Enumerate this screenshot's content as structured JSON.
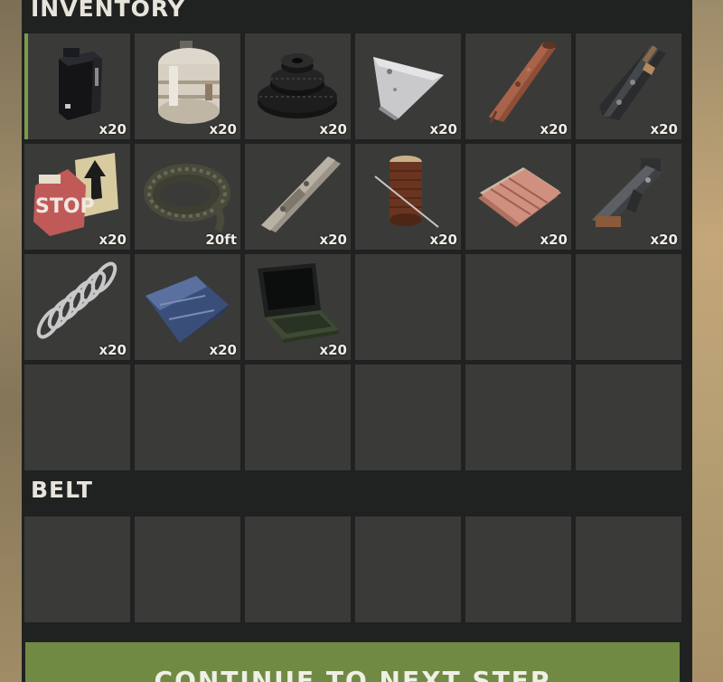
{
  "inventory": {
    "title": "INVENTORY",
    "slots": [
      {
        "item": "battery-icon",
        "qty": "x20"
      },
      {
        "item": "propane-tank-icon",
        "qty": "x20"
      },
      {
        "item": "gears-icon",
        "qty": "x20"
      },
      {
        "item": "metal-blade-icon",
        "qty": "x20"
      },
      {
        "item": "metal-pipe-icon",
        "qty": "x20"
      },
      {
        "item": "smg-body-icon",
        "qty": "x20"
      },
      {
        "item": "road-signs-icon",
        "qty": "x20"
      },
      {
        "item": "rope-icon",
        "qty": "20ft"
      },
      {
        "item": "rifle-body-icon",
        "qty": "x20"
      },
      {
        "item": "sewing-kit-icon",
        "qty": "x20"
      },
      {
        "item": "sheet-metal-icon",
        "qty": "x20"
      },
      {
        "item": "semi-auto-body-icon",
        "qty": "x20"
      },
      {
        "item": "metal-spring-icon",
        "qty": "x20"
      },
      {
        "item": "tarp-icon",
        "qty": "x20"
      },
      {
        "item": "laptop-icon",
        "qty": "x20"
      },
      {
        "item": "",
        "qty": ""
      },
      {
        "item": "",
        "qty": ""
      },
      {
        "item": "",
        "qty": ""
      },
      {
        "item": "",
        "qty": ""
      },
      {
        "item": "",
        "qty": ""
      },
      {
        "item": "",
        "qty": ""
      },
      {
        "item": "",
        "qty": ""
      },
      {
        "item": "",
        "qty": ""
      },
      {
        "item": "",
        "qty": ""
      }
    ]
  },
  "belt": {
    "title": "BELT",
    "slots": [
      {
        "item": "",
        "qty": ""
      },
      {
        "item": "",
        "qty": ""
      },
      {
        "item": "",
        "qty": ""
      },
      {
        "item": "",
        "qty": ""
      },
      {
        "item": "",
        "qty": ""
      },
      {
        "item": "",
        "qty": ""
      }
    ]
  },
  "continue_label": "CONTINUE TO NEXT STEP",
  "colors": {
    "panel": "#1f2220",
    "slot": "#3a3b38",
    "accent": "#718a43",
    "selected_marker": "#7b9a4b"
  }
}
